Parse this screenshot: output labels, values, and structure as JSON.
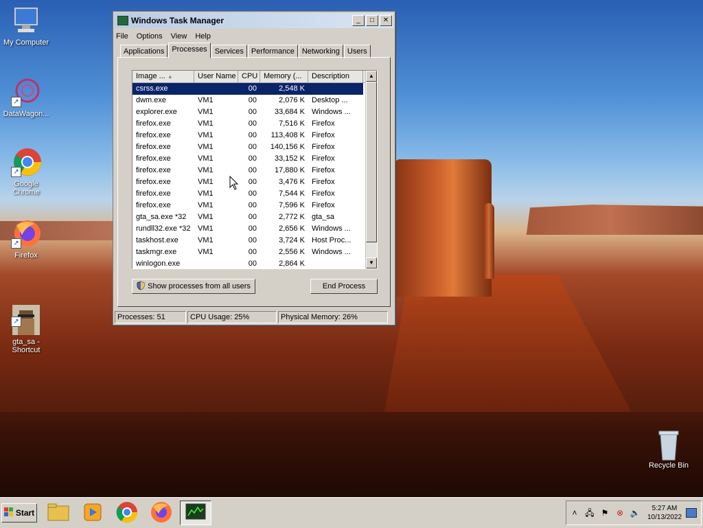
{
  "desktop": {
    "icons": [
      {
        "label": "My Computer"
      },
      {
        "label": "DataWagon..."
      },
      {
        "label": "Google Chrome"
      },
      {
        "label": "Firefox"
      },
      {
        "label": "gta_sa -\nShortcut"
      },
      {
        "label": "Recycle Bin"
      }
    ]
  },
  "window": {
    "title": "Windows Task Manager",
    "menu": [
      "File",
      "Options",
      "View",
      "Help"
    ],
    "tabs": [
      "Applications",
      "Processes",
      "Services",
      "Performance",
      "Networking",
      "Users"
    ],
    "active_tab": "Processes",
    "columns": [
      "Image ...",
      "User Name",
      "CPU",
      "Memory (...",
      "Description"
    ],
    "processes": [
      {
        "image": "csrss.exe",
        "user": "",
        "cpu": "00",
        "memory": "2,548 K",
        "desc": ""
      },
      {
        "image": "dwm.exe",
        "user": "VM1",
        "cpu": "00",
        "memory": "2,076 K",
        "desc": "Desktop ..."
      },
      {
        "image": "explorer.exe",
        "user": "VM1",
        "cpu": "00",
        "memory": "33,684 K",
        "desc": "Windows ..."
      },
      {
        "image": "firefox.exe",
        "user": "VM1",
        "cpu": "00",
        "memory": "7,516 K",
        "desc": "Firefox"
      },
      {
        "image": "firefox.exe",
        "user": "VM1",
        "cpu": "00",
        "memory": "113,408 K",
        "desc": "Firefox"
      },
      {
        "image": "firefox.exe",
        "user": "VM1",
        "cpu": "00",
        "memory": "140,156 K",
        "desc": "Firefox"
      },
      {
        "image": "firefox.exe",
        "user": "VM1",
        "cpu": "00",
        "memory": "33,152 K",
        "desc": "Firefox"
      },
      {
        "image": "firefox.exe",
        "user": "VM1",
        "cpu": "00",
        "memory": "17,880 K",
        "desc": "Firefox"
      },
      {
        "image": "firefox.exe",
        "user": "VM1",
        "cpu": "00",
        "memory": "3,476 K",
        "desc": "Firefox"
      },
      {
        "image": "firefox.exe",
        "user": "VM1",
        "cpu": "00",
        "memory": "7,544 K",
        "desc": "Firefox"
      },
      {
        "image": "firefox.exe",
        "user": "VM1",
        "cpu": "00",
        "memory": "7,596 K",
        "desc": "Firefox"
      },
      {
        "image": "gta_sa.exe *32",
        "user": "VM1",
        "cpu": "00",
        "memory": "2,772 K",
        "desc": "gta_sa"
      },
      {
        "image": "rundll32.exe *32",
        "user": "VM1",
        "cpu": "00",
        "memory": "2,656 K",
        "desc": "Windows ..."
      },
      {
        "image": "taskhost.exe",
        "user": "VM1",
        "cpu": "00",
        "memory": "3,724 K",
        "desc": "Host Proc..."
      },
      {
        "image": "taskmgr.exe",
        "user": "VM1",
        "cpu": "00",
        "memory": "2,556 K",
        "desc": "Windows ..."
      },
      {
        "image": "winlogon.exe",
        "user": "",
        "cpu": "00",
        "memory": "2,864 K",
        "desc": ""
      }
    ],
    "show_all_label": "Show processes from all users",
    "end_process_label": "End Process",
    "status": {
      "processes": "Processes: 51",
      "cpu": "CPU Usage: 25%",
      "memory": "Physical Memory: 26%"
    }
  },
  "taskbar": {
    "start_label": "Start",
    "clock_time": "5:27 AM",
    "clock_date": "10/13/2022"
  }
}
